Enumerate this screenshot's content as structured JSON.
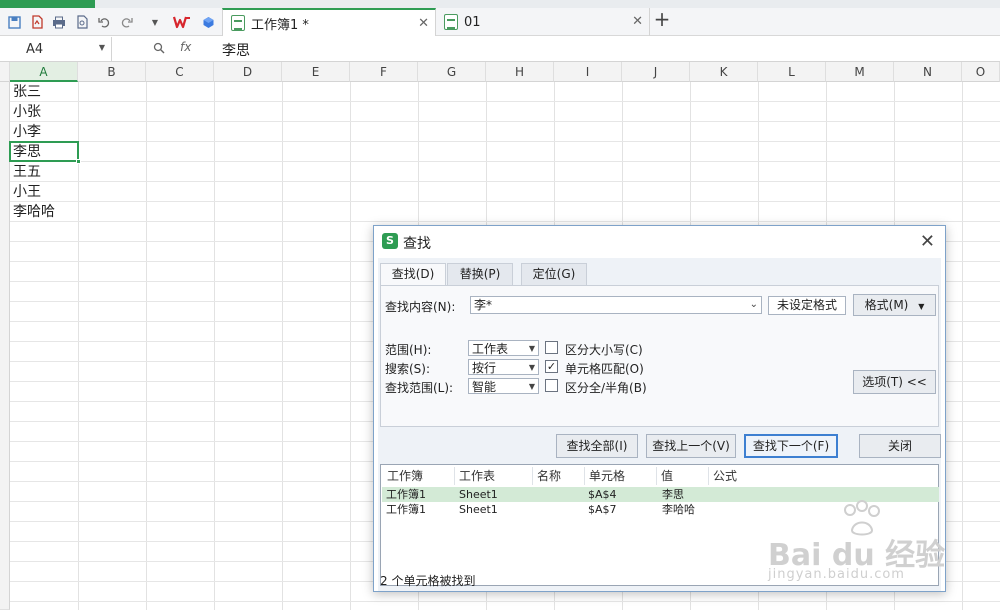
{
  "toolbar": {
    "icons": [
      "save-icon",
      "pdf-icon",
      "print-icon",
      "preview-icon",
      "undo-icon",
      "redo-icon",
      "more-icon",
      "wps-logo-icon",
      "cloud-icon"
    ]
  },
  "tabs": [
    {
      "label": "工作簿1 *",
      "active": true
    },
    {
      "label": "01",
      "active": false
    }
  ],
  "formula_bar": {
    "cell_ref": "A4",
    "fx": "fx",
    "value": "李思"
  },
  "columns": [
    "A",
    "B",
    "C",
    "D",
    "E",
    "F",
    "G",
    "H",
    "I",
    "J",
    "K",
    "L",
    "M",
    "N",
    "O"
  ],
  "cells": [
    "张三",
    "小张",
    "小李",
    "李思",
    "王五",
    "小王",
    "李哈哈"
  ],
  "dialog": {
    "title": "查找",
    "tabs": [
      "查找(D)",
      "替换(P)",
      "定位(G)"
    ],
    "find_label": "查找内容(N):",
    "find_value": "李*",
    "format_status": "未设定格式",
    "format_button": "格式(M)",
    "scope_label": "范围(H):",
    "scope_value": "工作表",
    "search_label": "搜索(S):",
    "search_value": "按行",
    "lookin_label": "查找范围(L):",
    "lookin_value": "智能",
    "match_case": "区分大小写(C)",
    "match_cell": "单元格匹配(O)",
    "match_width": "区分全/半角(B)",
    "options_button": "选项(T) <<",
    "find_all": "查找全部(I)",
    "find_prev": "查找上一个(V)",
    "find_next": "查找下一个(F)",
    "close": "关闭",
    "result_headers": [
      "工作簿",
      "工作表",
      "名称",
      "单元格",
      "值",
      "公式"
    ],
    "results": [
      {
        "book": "工作簿1",
        "sheet": "Sheet1",
        "name": "",
        "cell": "$A$4",
        "value": "李思",
        "formula": ""
      },
      {
        "book": "工作簿1",
        "sheet": "Sheet1",
        "name": "",
        "cell": "$A$7",
        "value": "李哈哈",
        "formula": ""
      }
    ],
    "status": "2 个单元格被找到",
    "checkboxes": {
      "match_case": false,
      "match_cell": true,
      "match_width": false
    }
  },
  "watermark": {
    "brand": "Bai du 经验",
    "url": "jingyan.baidu.com"
  }
}
